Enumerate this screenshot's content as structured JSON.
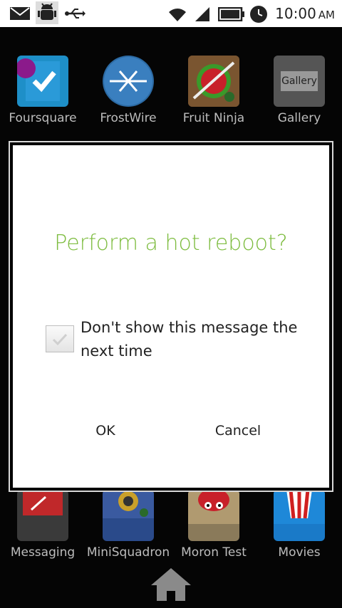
{
  "status_bar": {
    "time": "10:00",
    "ampm": "AM",
    "icons": [
      "mail-icon",
      "android-debug-icon",
      "usb-icon",
      "wifi-icon",
      "signal-icon",
      "battery-icon",
      "clock-icon"
    ]
  },
  "apps_top": [
    {
      "label": "Foursquare",
      "icon": "foursquare-icon"
    },
    {
      "label": "FrostWire",
      "icon": "frostwire-icon"
    },
    {
      "label": "Fruit Ninja",
      "icon": "fruit-ninja-icon"
    },
    {
      "label": "Gallery",
      "icon": "gallery-icon",
      "icon_text": "Gallery"
    }
  ],
  "apps_bottom": [
    {
      "label": "Messaging",
      "icon": "messaging-icon"
    },
    {
      "label": "MiniSquadron",
      "icon": "minisquadron-icon"
    },
    {
      "label": "Moron Test",
      "icon": "moron-test-icon"
    },
    {
      "label": "Movies",
      "icon": "movies-icon"
    }
  ],
  "dialog": {
    "title": "Perform a hot reboot?",
    "checkbox_label": "Don't show this message the next time",
    "checkbox_checked": false,
    "ok_label": "OK",
    "cancel_label": "Cancel"
  },
  "colors": {
    "title_green": "#7dbc3f",
    "background": "#000000",
    "dialog_bg": "#ffffff"
  }
}
